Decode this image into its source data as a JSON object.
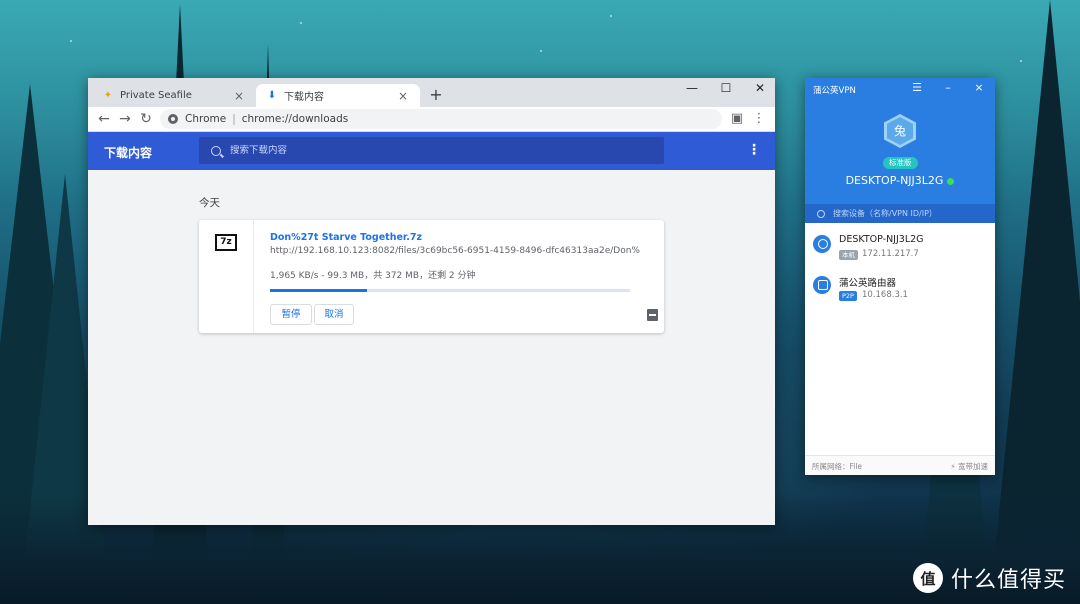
{
  "chrome": {
    "tabs": [
      {
        "label": "Private Seafile",
        "icon": "seafile-icon"
      },
      {
        "label": "下载内容",
        "icon": "download-icon"
      }
    ],
    "window_controls": {
      "minimize": "—",
      "maximize": "☐",
      "close": "✕"
    },
    "address": {
      "site": "Chrome",
      "url": "chrome://downloads"
    },
    "downloads": {
      "title": "下载内容",
      "search_placeholder": "搜索下载内容",
      "day": "今天",
      "item": {
        "file_name": "Don%27t Starve Together.7z",
        "url": "http://192.168.10.123:8082/files/3c69bc56-6951-4159-8496-dfc46313aa2e/Don%27t%20...",
        "status": "1,965 KB/s - 99.3 MB，共 372 MB，还剩 2 分钟",
        "progress_fraction": 0.27,
        "pause_label": "暂停",
        "cancel_label": "取消",
        "type_badge": "7z"
      }
    }
  },
  "vpn": {
    "title": "蒲公英VPN",
    "plan": "标准版",
    "device_name": "DESKTOP-NJJ3L2G",
    "avatar_char": "兔",
    "search_placeholder": "搜索设备（名称/VPN ID/IP）",
    "devices": [
      {
        "name": "DESKTOP-NJJ3L2G",
        "tag": "本机",
        "ip": "172.11.217.7"
      },
      {
        "name": "蒲公英路由器",
        "tag": "P2P",
        "ip": "10.168.3.1"
      }
    ],
    "footer": {
      "network": "所属网络：File",
      "accel": "宽带加速"
    }
  },
  "watermark": {
    "text": "什么值得买",
    "logo_char": "值"
  }
}
